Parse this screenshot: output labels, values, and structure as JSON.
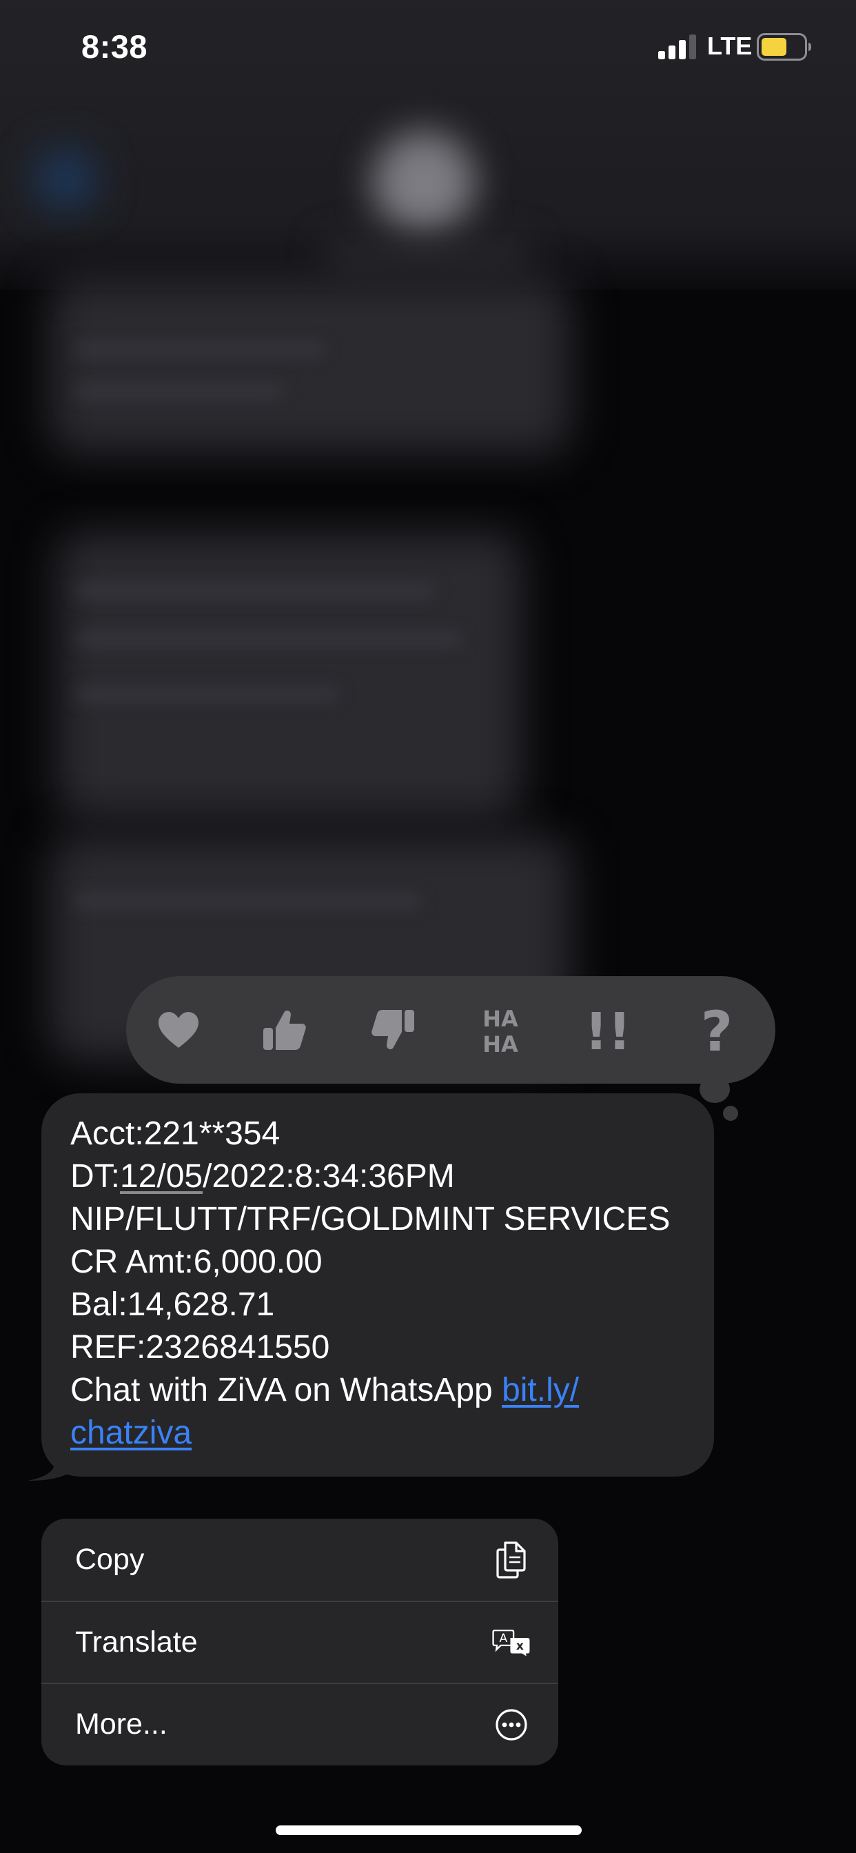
{
  "status_bar": {
    "time": "8:38",
    "network": "LTE",
    "signal_bars": 3,
    "battery_color": "#f5d33f"
  },
  "tapbacks": [
    {
      "name": "heart",
      "icon": "heart-icon"
    },
    {
      "name": "thumbs-up",
      "icon": "thumbs-up-icon"
    },
    {
      "name": "thumbs-down",
      "icon": "thumbs-down-icon"
    },
    {
      "name": "haha",
      "icon": "haha-icon",
      "text_top": "HA",
      "text_bottom": "HA"
    },
    {
      "name": "exclamation",
      "icon": "double-exclamation-icon",
      "text": "!!"
    },
    {
      "name": "question",
      "icon": "question-mark-icon",
      "text": "?"
    }
  ],
  "message": {
    "line1": "Acct:221**354",
    "line2_prefix": "DT:",
    "line2_date": "12/05",
    "line2_suffix": "/2022:8:34:36PM",
    "line3": "NIP/FLUTT/TRF/GOLDMINT SERVICES",
    "line4": "CR Amt:6,000.00",
    "line5": "Bal:14,628.71",
    "line6": "REF:2326841550",
    "line7_text": "Chat with ZiVA on WhatsApp ",
    "line7_link": "bit.ly/",
    "line8_link": "chatziva"
  },
  "context_menu": {
    "copy_label": "Copy",
    "translate_label": "Translate",
    "more_label": "More..."
  },
  "colors": {
    "accent_link": "#3a82f7",
    "bubble": "#262628",
    "tapback_bar": "#3a3a3c",
    "tapback_icon": "#8e8e93"
  }
}
